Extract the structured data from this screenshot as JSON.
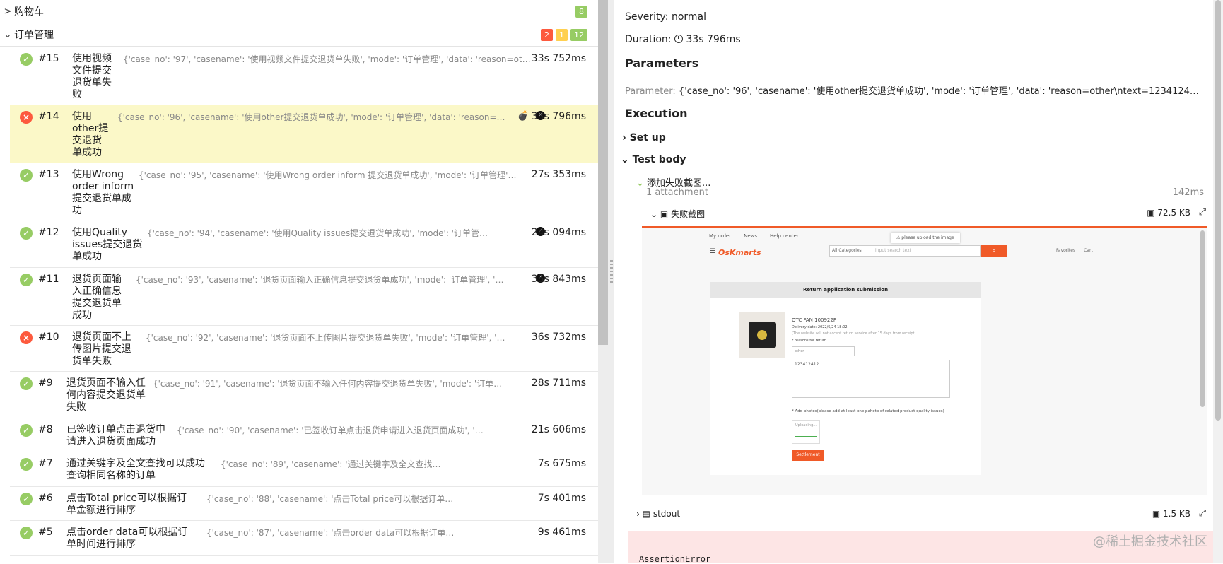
{
  "groups": [
    {
      "title": "购物车",
      "chevron": ">",
      "badges": [
        {
          "text": "8",
          "color": "#97cc64"
        }
      ]
    },
    {
      "title": "订单管理",
      "chevron": "⌄",
      "badges": [
        {
          "text": "2",
          "color": "#fd5a3e"
        },
        {
          "text": "1",
          "color": "#ffd050"
        },
        {
          "text": "12",
          "color": "#97cc64"
        }
      ]
    }
  ],
  "tests": [
    {
      "num": "#15",
      "status": "passed",
      "name": "使用视频文件提交退货单失败",
      "params": "{'case_no': '97', 'casename': '使用视频文件提交退货单失败', 'mode': '订单管理', 'data': 'reason=other\\ntext=12...",
      "duration": "33s 752ms"
    },
    {
      "num": "#14",
      "status": "failed",
      "name": "使用other提交退货单成功",
      "params": "{'case_no': '96', 'casename': '使用other提交退货单成功', 'mode': '订单管理', 'data': 'reason=other\\ntext=...",
      "duration": "33s 796ms",
      "selected": true
    },
    {
      "num": "#13",
      "status": "passed",
      "name": "使用Wrong order inform提交退货单成功",
      "params": "{'case_no': '95', 'casename': '使用Wrong order inform 提交退货单成功', 'mode': '订单管理', 'data': 'reason=...",
      "duration": "27s 353ms"
    },
    {
      "num": "#12",
      "status": "passed",
      "name": "使用Quality issues提交退货单成功",
      "params": "{'case_no': '94', 'casename': '使用Quality issues提交退货单成功', 'mode': '订单管理', 'data': 'reason=...",
      "duration": "24s 094ms"
    },
    {
      "num": "#11",
      "status": "passed",
      "name": "退货页面输入正确信息提交退货单成功",
      "params": "{'case_no': '93', 'casename': '退货页面输入正确信息提交退货单成功', 'mode': '订单管理', 'data': 'reason...",
      "duration": "35s 843ms"
    },
    {
      "num": "#10",
      "status": "failed",
      "name": "退货页面不上传图片提交退货单失败",
      "params": "{'case_no': '92', 'casename': '退货页面不上传图片提交退货单失败', 'mode': '订单管理', 'data': 'reason=W...",
      "duration": "36s 732ms"
    },
    {
      "num": "#9",
      "status": "passed",
      "name": "退货页面不输入任何内容提交退货单失败",
      "params": "{'case_no': '91', 'casename': '退货页面不输入任何内容提交退货单失败', 'mode': '订单管理', 'data': 'reas...",
      "duration": "28s 711ms"
    },
    {
      "num": "#8",
      "status": "passed",
      "name": "已签收订单点击退货申请进入退货页面成功",
      "params": "{'case_no': '90', 'casename': '已签收订单点击退货申请进入退货页面成功', 'mode': '订单管理', 'd...",
      "duration": "21s 606ms"
    },
    {
      "num": "#7",
      "status": "passed",
      "name": "通过关键字及全文查找可以成功查询相同名称的订单",
      "params": "{'case_no': '89', 'casename': '通过关键字及全文查找可以成功查询相同名称的订单', 'm...",
      "duration": "7s 675ms"
    },
    {
      "num": "#6",
      "status": "passed",
      "name": "点击Total price可以根据订单金额进行排序",
      "params": "{'case_no': '88', 'casename': '点击Total price可以根据订单金额进行排序', 'mode': '订单管...",
      "duration": "7s 401ms"
    },
    {
      "num": "#5",
      "status": "passed",
      "name": "点击order data可以根据订单时间进行排序",
      "params": "{'case_no': '87', 'casename': '点击order data可以根据订单时间进行排序', 'mode': '订单管...",
      "duration": "9s 461ms"
    }
  ],
  "detail": {
    "severity": "Severity: normal",
    "duration_label": "Duration:",
    "duration_value": "33s 796ms",
    "parameters_heading": "Parameters",
    "parameter_label": "Parameter:",
    "parameter_value": "{'case_no': '96', 'casename': '使用other提交退货单成功', 'mode': '订单管理', 'data': 'reason=other\\ntext=123412412\\nim...",
    "execution_heading": "Execution",
    "setup": "Set up",
    "test_body": "Test body",
    "step_name": "添加失败截图...",
    "attachments": "1 attachment",
    "step_time": "142ms",
    "attachment_name": "失败截图",
    "attachment_size": "72.5 KB",
    "stdout_name": "stdout",
    "stdout_size": "1.5 KB",
    "error_text": "AssertionError",
    "watermark": "@稀土掘金技术社区"
  },
  "screenshot": {
    "nav": [
      "My order",
      "News",
      "Help center"
    ],
    "tooltip": "⚠ please upload the image",
    "logo": "OsKmarts",
    "category": "All Categories",
    "search_placeholder": "input search text",
    "tools": [
      "Favorites",
      "Cart"
    ],
    "panel_title": "Return application submission",
    "product_name": "OTC FAN 100922F",
    "delivery_date": "Delivery date: 2022/6/24 18:02",
    "note": "(The website will not accept return service after 15 days from receipt)",
    "reason_label": "* reasons for return",
    "reason_value": "other",
    "textarea": "123412412",
    "photos_label": "* Add photos(please add at least one pahoto of related product quality issues)",
    "uploading": "Uploading...",
    "settle": "Settlement"
  },
  "colors": {
    "passed": "#97cc64",
    "failed": "#fd5a3e",
    "accent": "#f05a28"
  }
}
